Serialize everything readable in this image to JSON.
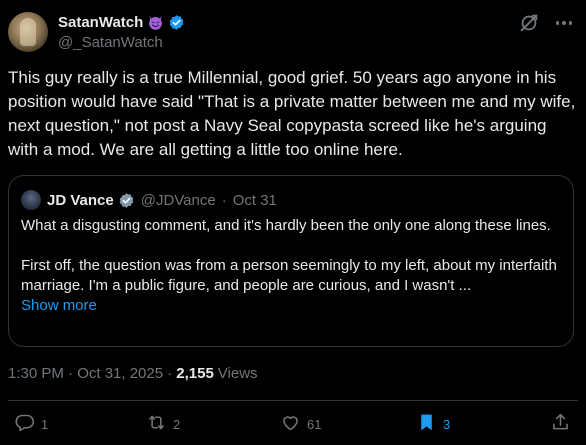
{
  "author": {
    "name": "SatanWatch",
    "handle": "@_SatanWatch",
    "emoji": "smiling-devil-emoji",
    "verified": true
  },
  "tweet": {
    "text": "This guy really is a true Millennial, good grief. 50 years ago anyone in his position would have said \"That is a private matter between me and my wife, next question,\" not post a Navy Seal copypasta screed like he's arguing with a mod. We are all getting a little too online here."
  },
  "quote": {
    "name": "JD Vance",
    "handle": "@JDVance",
    "separator": "·",
    "date": "Oct 31",
    "paragraph1": "What a disgusting comment, and it's hardly been the only one along these lines.",
    "paragraph2": "First off, the question was from a person seemingly to my left, about my interfaith marriage. I'm a public figure, and people are curious, and I wasn't ...",
    "show_more": "Show more"
  },
  "meta": {
    "timestamp": "1:30 PM · Oct 31, 2025 ·",
    "views_count": "2,155",
    "views_label": "Views"
  },
  "actions": {
    "replies": "1",
    "reposts": "2",
    "likes": "61",
    "bookmarks": "3"
  },
  "colors": {
    "background": "#000000",
    "text": "#e7e9ea",
    "muted": "#71767b",
    "accent": "#1d9bf0",
    "border": "#2f3336"
  }
}
